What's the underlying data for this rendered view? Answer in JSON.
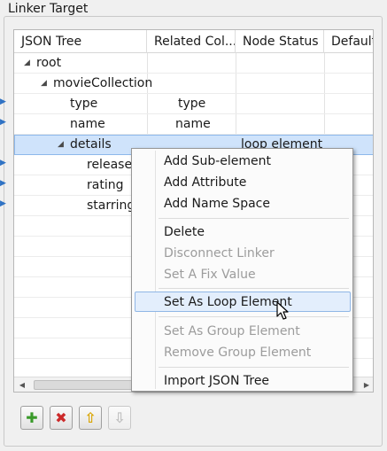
{
  "panel": {
    "title": "Linker Target"
  },
  "columns": [
    "JSON Tree",
    "Related Col...",
    "Node Status",
    "Default"
  ],
  "rows": [
    {
      "name": "root",
      "related": "",
      "status": "",
      "toggle": "◢"
    },
    {
      "name": "movieCollection",
      "related": "",
      "status": "",
      "toggle": "◢"
    },
    {
      "name": "type",
      "related": "type",
      "status": "",
      "toggle": ""
    },
    {
      "name": "name",
      "related": "name",
      "status": "",
      "toggle": ""
    },
    {
      "name": "details",
      "related": "",
      "status": "loop element",
      "toggle": "◢"
    },
    {
      "name": "release",
      "related": "",
      "status": "",
      "toggle": ""
    },
    {
      "name": "rating",
      "related": "",
      "status": "",
      "toggle": ""
    },
    {
      "name": "starring",
      "related": "",
      "status": "",
      "toggle": ""
    }
  ],
  "context_menu": {
    "items": [
      {
        "label": "Add Sub-element",
        "enabled": true
      },
      {
        "label": "Add Attribute",
        "enabled": true
      },
      {
        "label": "Add Name Space",
        "enabled": true
      },
      {
        "label": "Delete",
        "enabled": true
      },
      {
        "label": "Disconnect Linker",
        "enabled": false
      },
      {
        "label": "Set A Fix Value",
        "enabled": false
      },
      {
        "label": "Set As Loop Element",
        "enabled": true,
        "highlighted": true
      },
      {
        "label": "Set As Group Element",
        "enabled": false
      },
      {
        "label": "Remove Group Element",
        "enabled": false
      },
      {
        "label": "Import JSON Tree",
        "enabled": true
      }
    ]
  },
  "toolbar": {
    "buttons": [
      {
        "icon": "add-icon",
        "glyph": "✚",
        "color": "#3a9a2a",
        "enabled": true
      },
      {
        "icon": "delete-icon",
        "glyph": "✖",
        "color": "#cc2a2a",
        "enabled": true
      },
      {
        "icon": "move-up-icon",
        "glyph": "⇧",
        "color": "#d8a400",
        "enabled": true
      },
      {
        "icon": "move-down-icon",
        "glyph": "⇩",
        "color": "#bdbdbd",
        "enabled": false
      }
    ]
  },
  "colors": {
    "selection": "#cfe3fb",
    "menu_highlight": "#e3eefc",
    "marker": "#2f72c4"
  }
}
